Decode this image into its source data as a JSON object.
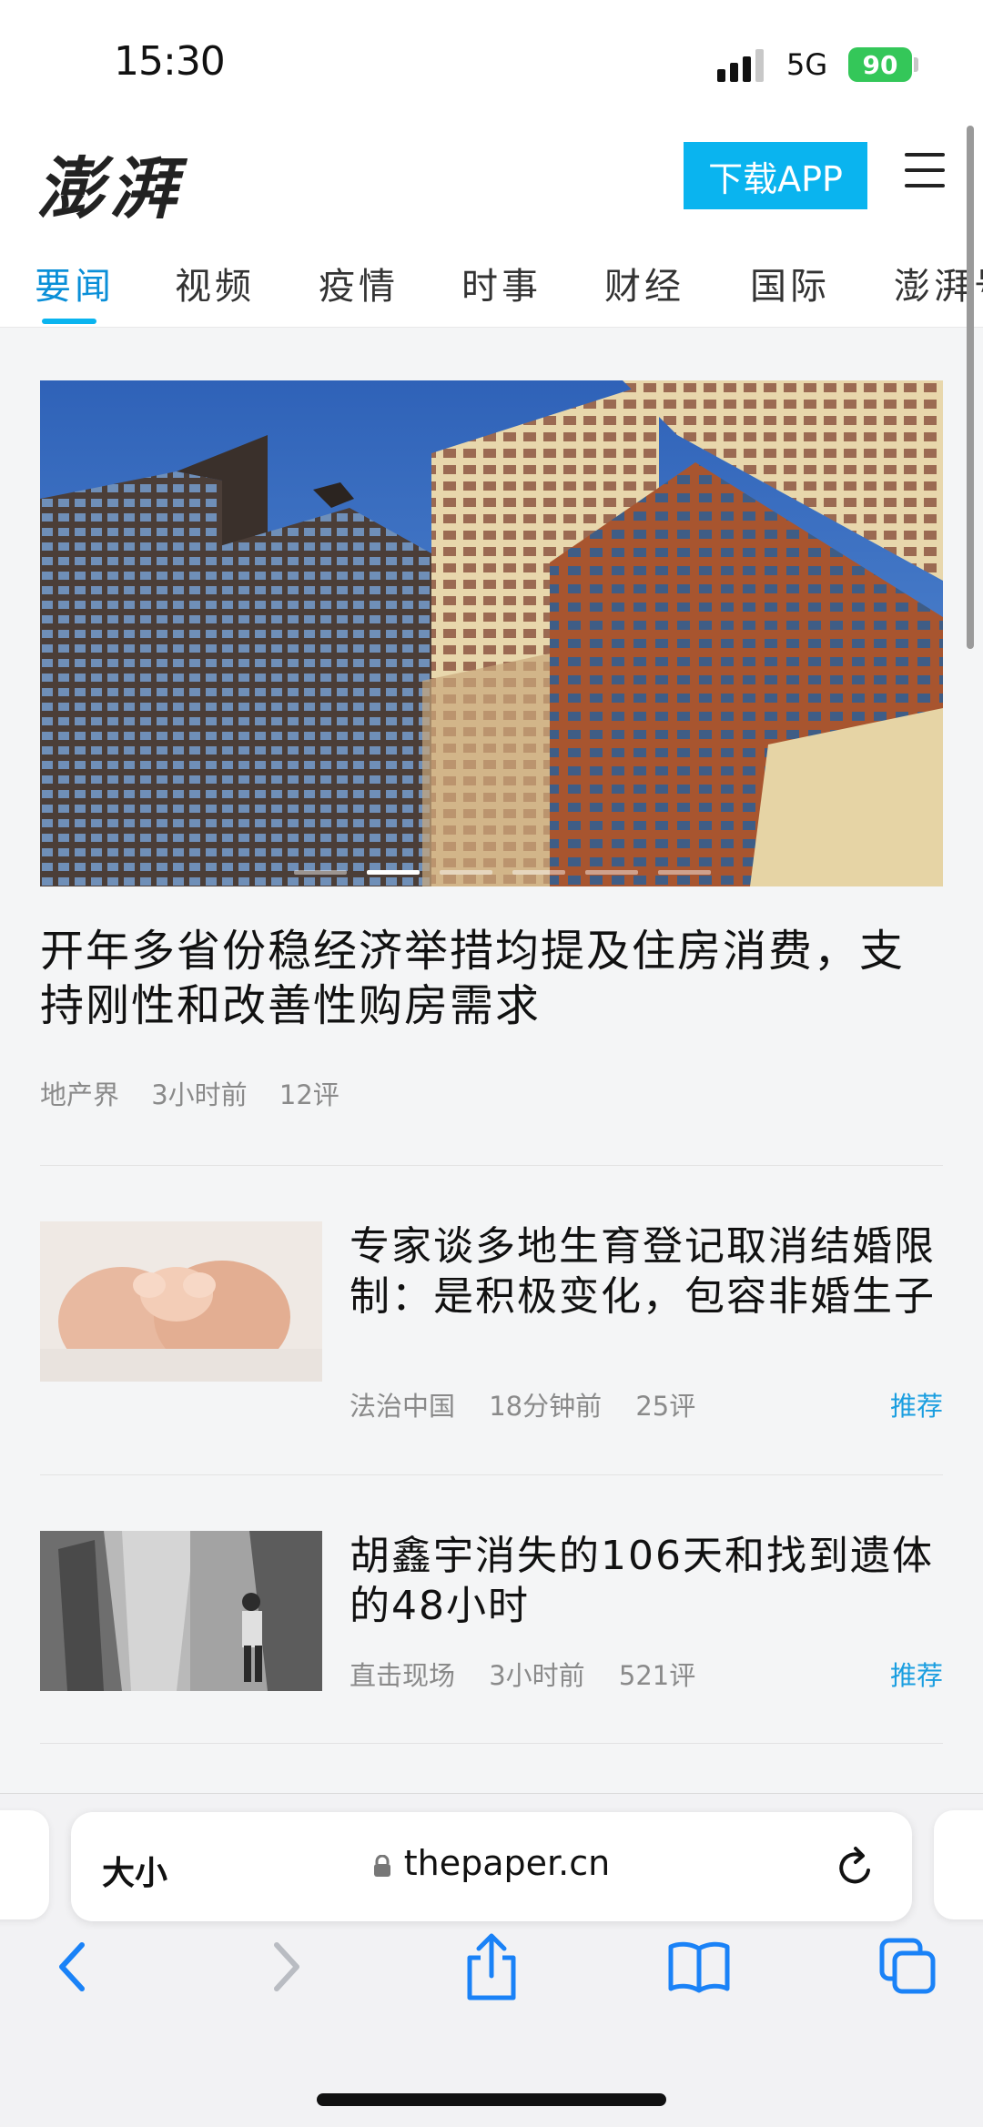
{
  "status": {
    "time": "15:30",
    "network": "5G",
    "battery": "90"
  },
  "header": {
    "logo": "澎湃",
    "download_label": "下载APP"
  },
  "tabs": [
    {
      "label": "要闻",
      "active": true
    },
    {
      "label": "视频"
    },
    {
      "label": "疫情"
    },
    {
      "label": "时事"
    },
    {
      "label": "财经"
    },
    {
      "label": "国际"
    },
    {
      "label": "澎湃号"
    }
  ],
  "hero": {
    "title": "开年多省份稳经济举措均提及住房消费，支持刚性和改善性购房需求",
    "source": "地产界",
    "time": "3小时前",
    "comments": "12评",
    "slide_count": 6,
    "active_slide": 2
  },
  "articles": [
    {
      "title": "专家谈多地生育登记取消结婚限制：是积极变化，包容非婚生子",
      "source": "法治中国",
      "time": "18分钟前",
      "comments": "25评",
      "tag": "推荐"
    },
    {
      "title": "胡鑫宇消失的106天和找到遗体的48小时",
      "source": "直击现场",
      "time": "3小时前",
      "comments": "521评",
      "tag": "推荐"
    }
  ],
  "browser": {
    "text_size_label": "大小",
    "url": "thepaper.cn"
  },
  "colors": {
    "accent": "#0ab4ef",
    "tag": "#1a9ee0",
    "battery": "#34c759"
  }
}
